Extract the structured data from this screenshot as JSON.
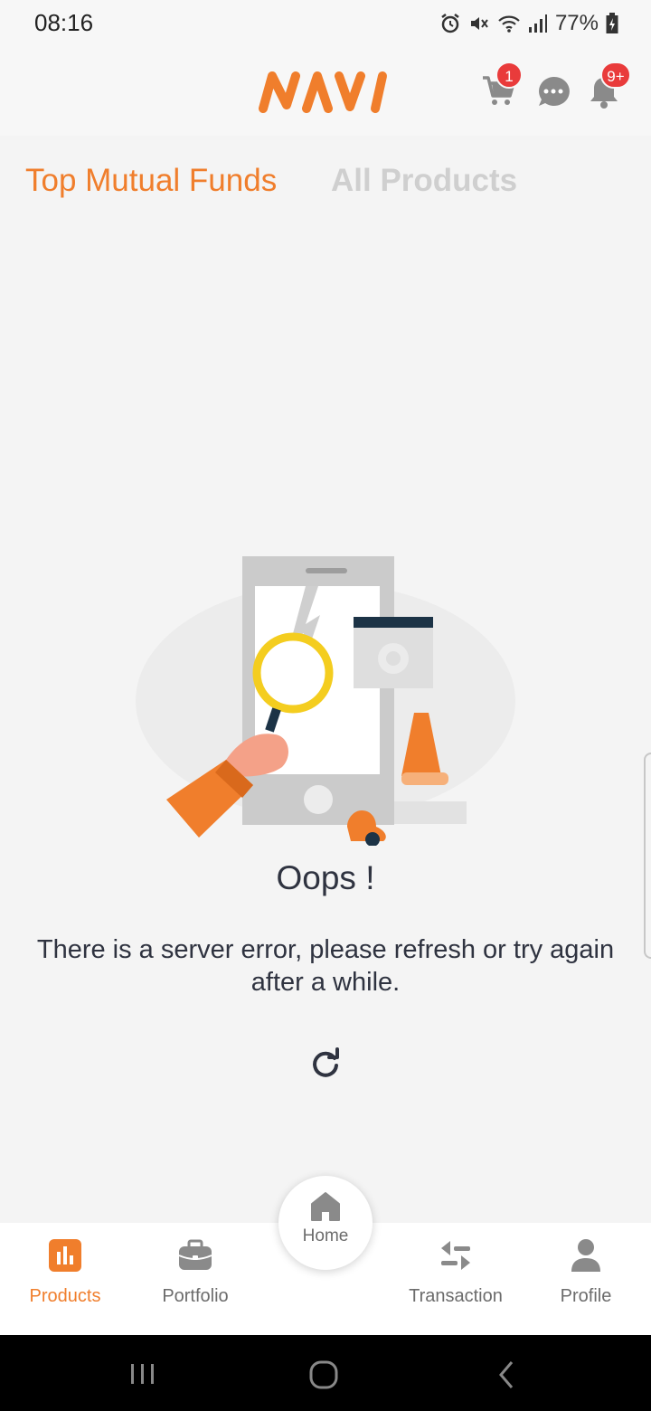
{
  "status_bar": {
    "time": "08:16",
    "battery": "77%",
    "icons": [
      "alarm-icon",
      "mute-icon",
      "wifi-icon",
      "signal-icon",
      "battery-icon"
    ]
  },
  "header": {
    "logo_text": "NAVI",
    "cart_badge": "1",
    "notification_badge": "9+",
    "brand_color": "#f07e2c",
    "badge_color": "#e93b3b"
  },
  "tabs": {
    "top_mutual_funds": "Top Mutual Funds",
    "all_products": "All Products"
  },
  "error": {
    "title": "Oops !",
    "message": "There is a server error, please refresh or try again after a while."
  },
  "bottom_nav": {
    "products": "Products",
    "portfolio": "Portfolio",
    "home": "Home",
    "transaction": "Transaction",
    "profile": "Profile",
    "active": "Products"
  }
}
